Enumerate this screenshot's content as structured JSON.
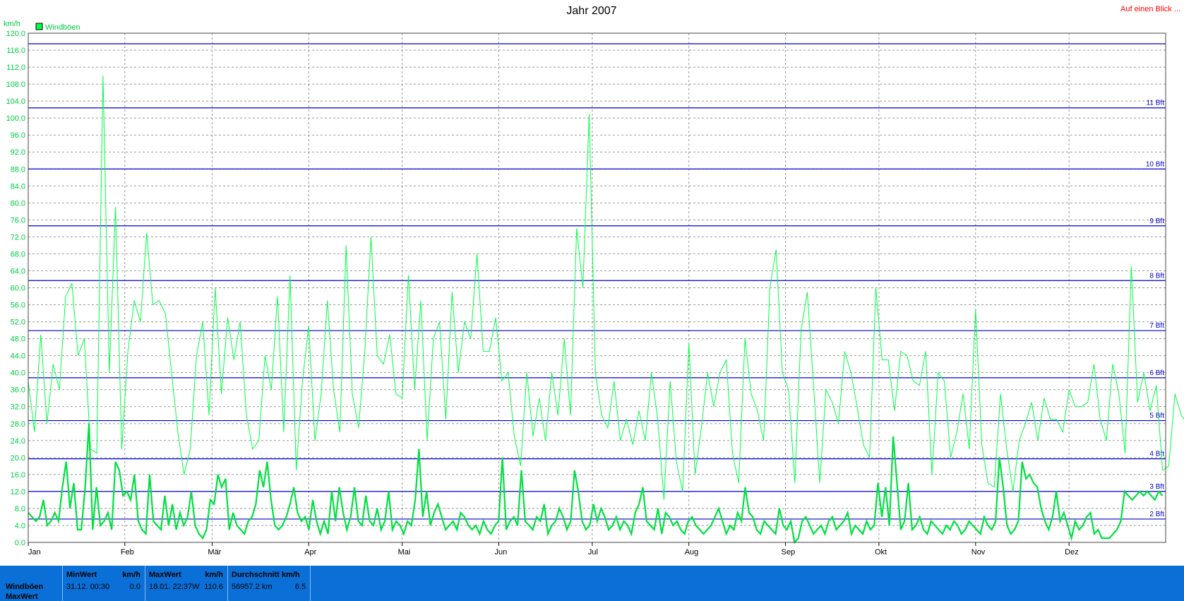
{
  "chart_data": {
    "type": "line",
    "title": "Jahr 2007",
    "ylabel": "km/h",
    "ylim": [
      0,
      120
    ],
    "grid": true,
    "legend_position": "top-left",
    "x_ticks": [
      "Jan",
      "Feb",
      "Mär",
      "Apr",
      "Mai",
      "Jun",
      "Jul",
      "Aug",
      "Sep",
      "Okt",
      "Nov",
      "Dez"
    ],
    "y_ticks": [
      "0.0",
      "4.0",
      "8.0",
      "12.0",
      "16.0",
      "20.0",
      "24.0",
      "28.0",
      "32.0",
      "36.0",
      "40.0",
      "44.0",
      "48.0",
      "52.0",
      "56.0",
      "60.0",
      "64.0",
      "68.0",
      "72.0",
      "76.0",
      "80.0",
      "84.0",
      "88.0",
      "92.0",
      "96.0",
      "100.0",
      "104.0",
      "108.0",
      "112.0",
      "116.0",
      "120.0"
    ],
    "beaufort_lines": [
      {
        "label": "2 Bft",
        "value": 5.5
      },
      {
        "label": "3 Bft",
        "value": 12
      },
      {
        "label": "4 Bft",
        "value": 19.7
      },
      {
        "label": "5 Bft",
        "value": 28.7
      },
      {
        "label": "6 Bft",
        "value": 38.8
      },
      {
        "label": "7 Bft",
        "value": 49.9
      },
      {
        "label": "8 Bft",
        "value": 61.7
      },
      {
        "label": "9 Bft",
        "value": 74.6
      },
      {
        "label": "10 Bft",
        "value": 88
      },
      {
        "label": "11 Bft",
        "value": 102.4
      },
      {
        "label": "",
        "value": 117.5
      }
    ],
    "series": [
      {
        "name": "Windböen",
        "color": "#00ff44",
        "x_days": [
          0,
          2,
          4,
          6,
          8,
          10,
          12,
          14,
          16,
          18,
          20,
          22,
          24,
          26,
          28,
          30,
          32,
          34,
          36,
          38,
          40,
          42,
          44,
          46,
          48,
          50,
          52,
          54,
          56,
          58,
          60,
          62,
          64,
          66,
          68,
          70,
          72,
          74,
          76,
          78,
          80,
          82,
          84,
          86,
          88,
          90,
          92,
          94,
          96,
          98,
          100,
          102,
          104,
          106,
          108,
          110,
          112,
          114,
          116,
          118,
          120,
          122,
          124,
          126,
          128,
          130,
          132,
          134,
          136,
          138,
          140,
          142,
          144,
          146,
          148,
          150,
          152,
          154,
          156,
          158,
          160,
          162,
          164,
          166,
          168,
          170,
          172,
          174,
          176,
          178,
          180,
          182,
          184,
          186,
          188,
          190,
          192,
          194,
          196,
          198,
          200,
          202,
          204,
          206,
          208,
          210,
          212,
          214,
          216,
          218,
          220,
          222,
          224,
          226,
          228,
          230,
          232,
          234,
          236,
          238,
          240,
          242,
          244,
          246,
          248,
          250,
          252,
          254,
          256,
          258,
          260,
          262,
          264,
          266,
          268,
          270,
          272,
          274,
          276,
          278,
          280,
          282,
          284,
          286,
          288,
          290,
          292,
          294,
          296,
          298,
          300,
          302,
          304,
          306,
          308,
          310,
          312,
          314,
          316,
          318,
          320,
          322,
          324,
          326,
          328,
          330,
          332,
          334,
          336,
          338,
          340,
          342,
          344,
          346,
          348,
          350,
          352,
          354,
          356,
          358,
          360,
          362,
          364
        ],
        "values": [
          38,
          26,
          49,
          28,
          42,
          36,
          58,
          61,
          44,
          48,
          22,
          21,
          110,
          40,
          79,
          22,
          45,
          57,
          52,
          73,
          56,
          57,
          54,
          40,
          26,
          16,
          22,
          44,
          52,
          30,
          60,
          35,
          53,
          43,
          52,
          30,
          22,
          24,
          44,
          36,
          58,
          26,
          63,
          17,
          38,
          51,
          24,
          35,
          57,
          36,
          26,
          70,
          35,
          27,
          45,
          72,
          44,
          42,
          49,
          35,
          34,
          63,
          36,
          57,
          24,
          48,
          52,
          29,
          59,
          40,
          52,
          48,
          68,
          45,
          45,
          53,
          38,
          40,
          25,
          18,
          40,
          25,
          34,
          24,
          40,
          30,
          48,
          30,
          74,
          60,
          101,
          40,
          30,
          27,
          38,
          24,
          29,
          23,
          31,
          24,
          40,
          29,
          10,
          38,
          19,
          12,
          47,
          16,
          27,
          40,
          32,
          40,
          43,
          21,
          14,
          48,
          35,
          31,
          24,
          60,
          69,
          40,
          36,
          14,
          50,
          59,
          37,
          14,
          36,
          33,
          28,
          45,
          40,
          32,
          23,
          20,
          60,
          43,
          43,
          31,
          45,
          44,
          38,
          37,
          45,
          16,
          40,
          38,
          20,
          26,
          35,
          22,
          55,
          23,
          14,
          13,
          35,
          22,
          12,
          24,
          28,
          33,
          24,
          34,
          29,
          29,
          26,
          36,
          32,
          32,
          33,
          42,
          29,
          24,
          42,
          35,
          21,
          65,
          33,
          40,
          31,
          37,
          17,
          18,
          35,
          30,
          28,
          30,
          40,
          22,
          14,
          24,
          1,
          18,
          23,
          16,
          28,
          55,
          26,
          31,
          38,
          46,
          19,
          29,
          20,
          22,
          42,
          26,
          27,
          12,
          32,
          14,
          36,
          24,
          65,
          55,
          45,
          36,
          34,
          22,
          26,
          23,
          48,
          37,
          48,
          30,
          16,
          37,
          17,
          21,
          20,
          13,
          32,
          27,
          61,
          38,
          35,
          23,
          56,
          35,
          40,
          42,
          51,
          48,
          36,
          30,
          19,
          22,
          16,
          22,
          19,
          14,
          18,
          12,
          20,
          13,
          28,
          24,
          20,
          30,
          36,
          32,
          23,
          27,
          22,
          20,
          22,
          15,
          16,
          14,
          17,
          26,
          30,
          24,
          31,
          36,
          35,
          37,
          44,
          40,
          45,
          52,
          30,
          26,
          24,
          22,
          20,
          18,
          16,
          20,
          25,
          30,
          22,
          24,
          26,
          28,
          24,
          22,
          20,
          18,
          16,
          14,
          12,
          12,
          12,
          13,
          16,
          18,
          22,
          24,
          26,
          28,
          30,
          32,
          35,
          28,
          24,
          22,
          20,
          24,
          26,
          28,
          24,
          22,
          26,
          28,
          30,
          32,
          28,
          26,
          24,
          22,
          20,
          18,
          16,
          14,
          12,
          14,
          16,
          18,
          20,
          22,
          24,
          26,
          28
        ]
      },
      {
        "name": "Windböen Mittel",
        "color": "#00e040",
        "values": [
          7,
          6,
          5,
          6,
          10,
          4,
          5,
          7,
          5,
          13,
          19,
          8,
          14,
          3,
          3,
          13,
          28,
          3,
          13,
          4,
          5,
          7,
          3,
          19,
          17,
          11,
          12,
          10,
          16,
          5,
          3,
          2,
          16,
          5,
          4,
          3,
          11,
          4,
          9,
          3,
          7,
          4,
          6,
          12,
          4,
          2,
          1,
          3,
          10,
          9,
          16,
          13,
          15,
          3,
          7,
          4,
          3,
          2,
          5,
          6,
          9,
          17,
          13,
          19,
          10,
          4,
          3,
          4,
          6,
          9,
          13,
          7,
          5,
          6,
          3,
          10,
          5,
          2,
          5,
          2,
          12,
          5,
          13,
          7,
          3,
          6,
          13,
          5,
          4,
          11,
          5,
          4,
          8,
          3,
          5,
          12,
          3,
          5,
          4,
          2,
          5,
          4,
          10,
          22,
          6,
          12,
          4,
          7,
          9,
          6,
          3,
          4,
          5,
          3,
          7,
          6,
          4,
          3,
          4,
          2,
          5,
          3,
          2,
          4,
          5,
          20,
          3,
          5,
          6,
          4,
          17,
          5,
          4,
          3,
          6,
          5,
          9,
          2,
          4,
          5,
          8,
          6,
          3,
          5,
          17,
          12,
          5,
          3,
          4,
          9,
          5,
          8,
          6,
          3,
          4,
          6,
          3,
          5,
          4,
          2,
          7,
          9,
          13,
          5,
          4,
          3,
          8,
          2,
          7,
          6,
          4,
          5,
          3,
          2,
          5,
          6,
          4,
          3,
          2,
          3,
          4,
          6,
          8,
          5,
          2,
          4,
          3,
          7,
          5,
          13,
          7,
          6,
          3,
          2,
          5,
          4,
          3,
          2,
          8,
          4,
          3,
          5,
          0,
          1,
          5,
          6,
          4,
          2,
          3,
          4,
          2,
          5,
          6,
          3,
          4,
          5,
          7,
          2,
          4,
          3,
          2,
          5,
          3,
          4,
          14,
          6,
          13,
          4,
          25,
          14,
          3,
          5,
          14,
          3,
          4,
          6,
          3,
          2,
          5,
          4,
          3,
          2,
          4,
          3,
          5,
          4,
          2,
          3,
          5,
          4,
          3,
          2,
          6,
          4,
          3,
          5,
          20,
          13,
          4,
          2,
          3,
          5,
          19,
          15,
          16,
          14,
          13,
          8,
          5,
          3,
          6,
          12,
          5,
          7,
          4,
          1,
          5,
          3,
          4,
          6,
          7,
          2,
          3,
          1,
          1,
          1,
          2,
          3,
          5,
          12,
          11,
          10,
          11,
          12,
          11,
          12,
          11,
          10,
          12,
          11
        ]
      }
    ]
  },
  "header": {
    "title": "Jahr 2007",
    "link_label": "Auf einen Blick ...",
    "unit_label": "km/h",
    "legend_label": "Windböen"
  },
  "stats": {
    "row_label_1": "Windböen",
    "row_label_2": "MaxWert",
    "min_header": "MinWert",
    "min_unit": "km/h",
    "min_date": "31.12.  00:30",
    "min_value": "0.0",
    "max_header": "MaxWert",
    "max_unit": "km/h",
    "max_date": "18.01.  22:37W",
    "max_value": "110.6",
    "avg_header": "Durchschnitt km/h",
    "avg_distance": "56957.2 km",
    "avg_value": "6.5"
  },
  "colors": {
    "series_green": "#00ff44",
    "beaufort_blue": "#0000cc",
    "stats_bar": "#0a6fd6",
    "link_red": "#ff0000"
  }
}
